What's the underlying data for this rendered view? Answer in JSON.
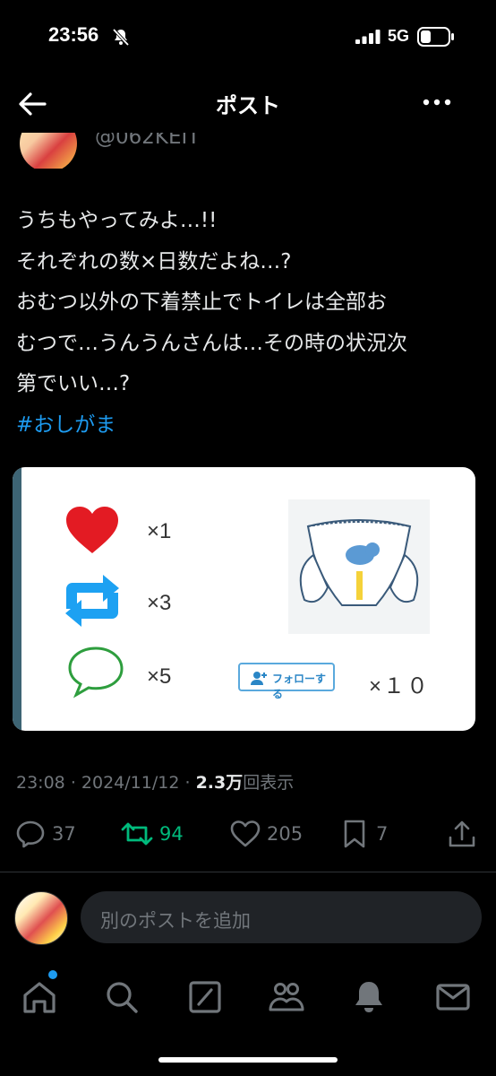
{
  "status_bar": {
    "time": "23:56",
    "network": "5G"
  },
  "nav": {
    "title": "ポスト"
  },
  "author": {
    "handle": "@062KEIT"
  },
  "tweet": {
    "lines": [
      "うちもやってみよ…!!",
      "それぞれの数×日数だよね…?",
      "おむつ以外の下着禁止でトイレは全部お",
      "むつで…うんうんさんは…その時の状況次",
      "第でいい…?"
    ],
    "hashtag": "#おしがま"
  },
  "image": {
    "like_mult": "×1",
    "retweet_mult": "×3",
    "reply_mult": "×5",
    "follow_label": "フォローする",
    "follow_mult": "×１０"
  },
  "meta": {
    "time": "23:08",
    "date": "2024/11/12",
    "views_count": "2.3万",
    "views_label": "回表示"
  },
  "actions": {
    "replies": "37",
    "retweets": "94",
    "likes": "205",
    "bookmarks": "7"
  },
  "reply_bar": {
    "placeholder": "別のポストを追加"
  },
  "colors": {
    "accent": "#1d9bf0",
    "retweet_green": "#00ba7c",
    "muted": "#71767b",
    "background": "#000000"
  }
}
